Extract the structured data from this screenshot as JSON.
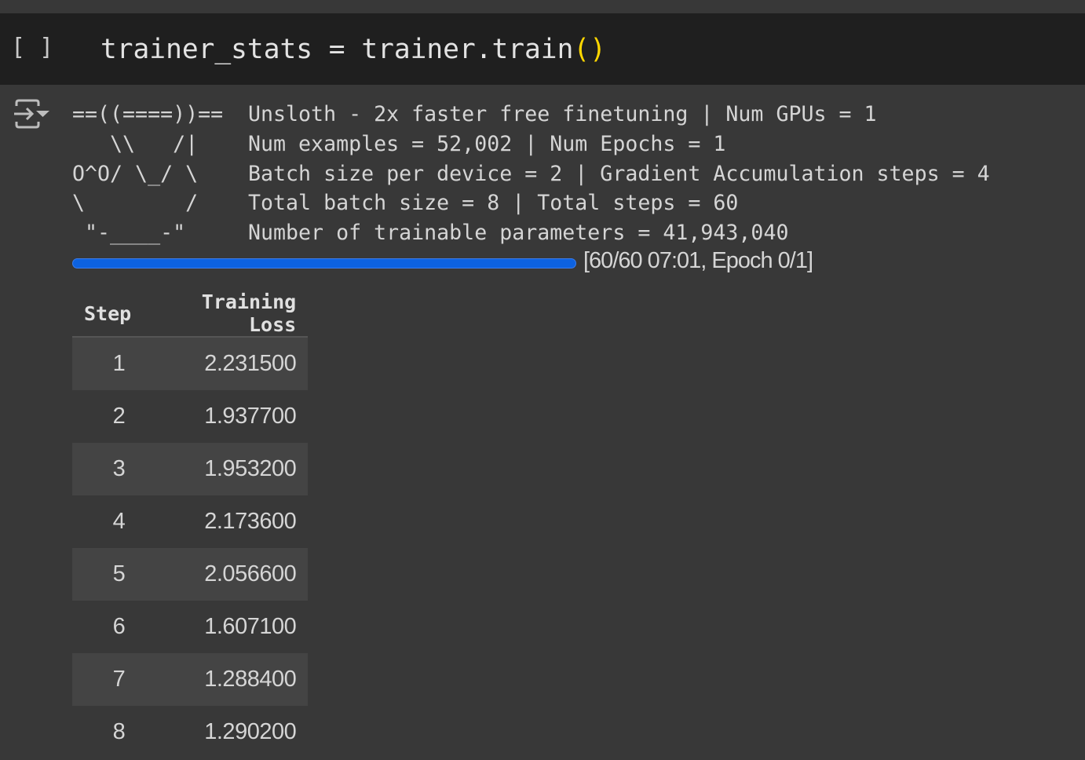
{
  "cell": {
    "run_label": "[ ]",
    "code_prefix": "trainer_stats = trainer.train",
    "code_open": "(",
    "code_close": ")"
  },
  "output": {
    "icon": "output-collapse-icon",
    "art_lines": [
      "==((====))==",
      "   \\\\   /|",
      "O^O/ \\_/ \\",
      "\\        /",
      " \"-____-\""
    ],
    "info_lines": [
      "Unsloth - 2x faster free finetuning | Num GPUs = 1",
      "Num examples = 52,002 | Num Epochs = 1",
      "Batch size per device = 2 | Gradient Accumulation steps = 4",
      "Total batch size = 8 | Total steps = 60",
      "Number of trainable parameters = 41,943,040"
    ],
    "progress": {
      "percent": 100,
      "text": "[60/60 07:01, Epoch 0/1]",
      "color": "#0d62e0"
    },
    "table": {
      "headers": [
        "Step",
        "Training Loss"
      ],
      "rows": [
        [
          "1",
          "2.231500"
        ],
        [
          "2",
          "1.937700"
        ],
        [
          "3",
          "1.953200"
        ],
        [
          "4",
          "2.173600"
        ],
        [
          "5",
          "2.056600"
        ],
        [
          "6",
          "1.607100"
        ],
        [
          "7",
          "1.288400"
        ],
        [
          "8",
          "1.290200"
        ]
      ]
    }
  }
}
